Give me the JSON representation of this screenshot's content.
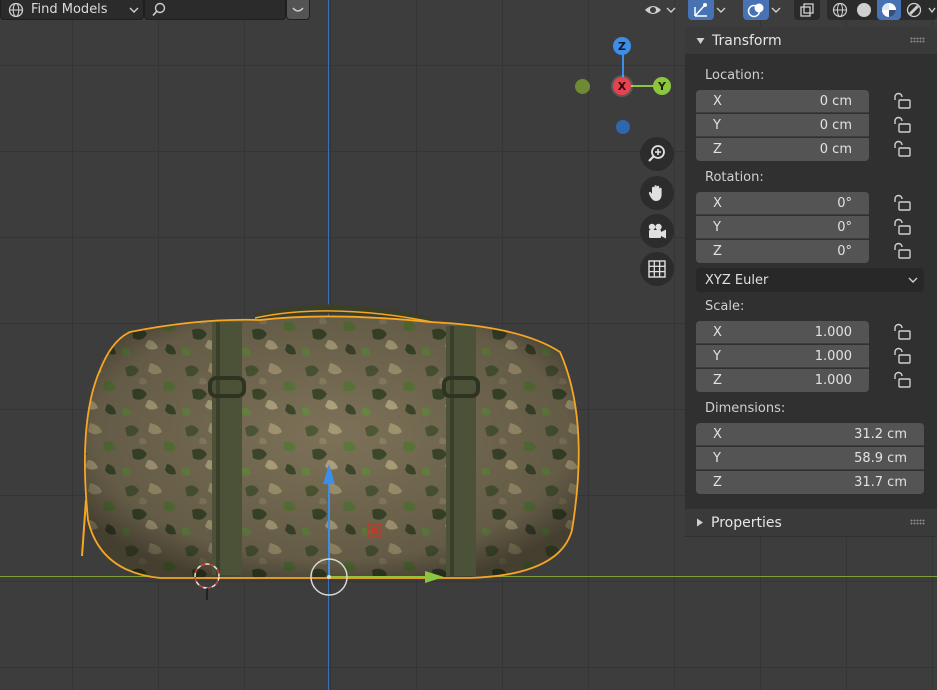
{
  "header": {
    "find_models_label": "Find Models",
    "search_placeholder": ""
  },
  "gizmo": {
    "z_label": "Z",
    "x_label": "X",
    "y_label": "Y"
  },
  "transform": {
    "title": "Transform",
    "location_label": "Location:",
    "location": [
      {
        "axis": "X",
        "value": "0 cm"
      },
      {
        "axis": "Y",
        "value": "0 cm"
      },
      {
        "axis": "Z",
        "value": "0 cm"
      }
    ],
    "rotation_label": "Rotation:",
    "rotation": [
      {
        "axis": "X",
        "value": "0°"
      },
      {
        "axis": "Y",
        "value": "0°"
      },
      {
        "axis": "Z",
        "value": "0°"
      }
    ],
    "rotation_mode": "XYZ Euler",
    "scale_label": "Scale:",
    "scale": [
      {
        "axis": "X",
        "value": "1.000"
      },
      {
        "axis": "Y",
        "value": "1.000"
      },
      {
        "axis": "Z",
        "value": "1.000"
      }
    ],
    "dimensions_label": "Dimensions:",
    "dimensions": [
      {
        "axis": "X",
        "value": "31.2 cm"
      },
      {
        "axis": "Y",
        "value": "58.9 cm"
      },
      {
        "axis": "Z",
        "value": "31.7 cm"
      }
    ]
  },
  "properties": {
    "title": "Properties"
  },
  "colors": {
    "accent": "#4772b3",
    "selection_outline": "#f5a623",
    "axis_x": "#e8414f",
    "axis_y": "#8cc63f",
    "axis_z": "#3d8ee6"
  }
}
